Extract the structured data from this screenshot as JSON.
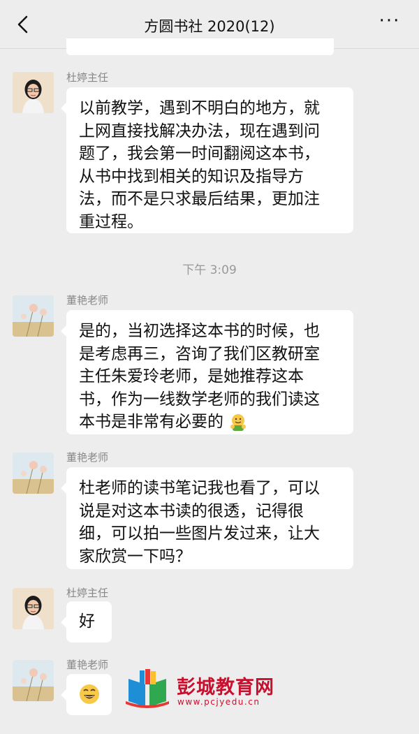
{
  "header": {
    "title": "方圆书社 2020(12)",
    "more_label": "···"
  },
  "messages": [
    {
      "sender": "杜婷主任",
      "text": "以前教学，遇到不明白的地方，就上网直接找解决办法，现在遇到问题了，我会第一时间翻阅这本书，从书中找到相关的知识及指导方法，而不是只求最后结果，更加注重过程。",
      "lines": [
        "以前教学，遇到不明白的地方，就",
        "上网直接找解决办法，现在遇到问",
        "题了，我会第一时间翻阅这本书，",
        "从书中找到相关的知识及指导方",
        "法，而不是只求最后结果，更加注",
        "重过程。"
      ]
    },
    {
      "sender": "董艳老师",
      "lines": [
        "是的，当初选择这本书的时候，也",
        "是考虑再三，咨询了我们区教研室",
        "主任朱爱玲老师，是她推荐这本",
        "书，作为一线数学老师的我们读这",
        "本书是非常有必要的"
      ]
    },
    {
      "sender": "董艳老师",
      "lines": [
        "杜老师的读书笔记我也看了，可以",
        "说是对这本书读的很透，记得很",
        "细，可以拍一些图片发过来，让大",
        "家欣赏一下吗？"
      ]
    },
    {
      "sender": "杜婷主任",
      "lines": [
        "好"
      ]
    },
    {
      "sender": "董艳老师",
      "emoji": "grinning-face"
    }
  ],
  "timestamp": "下午 3:09",
  "watermark": {
    "brand": "彭城教育网",
    "url": "www.pcjyedu.cn"
  },
  "colors": {
    "background": "#ededed",
    "bubble": "#ffffff",
    "watermark": "#c8102e"
  }
}
